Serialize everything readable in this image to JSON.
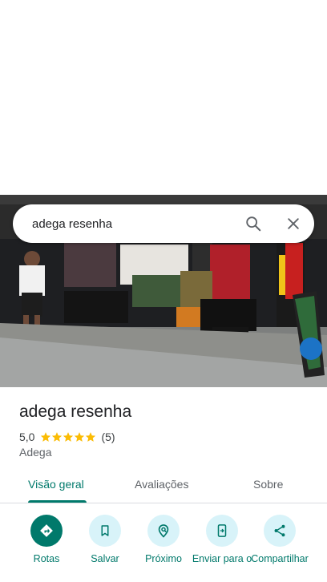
{
  "search": {
    "query": "adega resenha"
  },
  "place": {
    "name": "adega resenha",
    "rating": "5,0",
    "stars": 5,
    "review_count": "(5)",
    "category": "Adega"
  },
  "tabs": [
    {
      "label": "Visão geral",
      "active": true
    },
    {
      "label": "Avaliações",
      "active": false
    },
    {
      "label": "Sobre",
      "active": false
    }
  ],
  "actions": [
    {
      "label": "Rotas",
      "icon": "directions-icon"
    },
    {
      "label": "Salvar",
      "icon": "bookmark-icon"
    },
    {
      "label": "Próximo",
      "icon": "nearby-icon"
    },
    {
      "label": "Enviar para o",
      "icon": "send-to-phone-icon"
    },
    {
      "label": "Compartilhar",
      "icon": "share-icon"
    }
  ],
  "colors": {
    "accent": "#00796b",
    "action_bg": "#d8f3f9",
    "star": "#fbbc04"
  }
}
